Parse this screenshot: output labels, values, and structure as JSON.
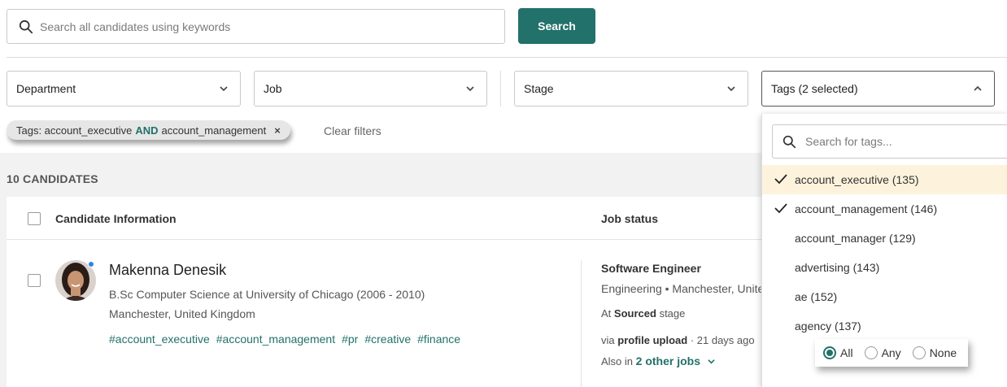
{
  "search": {
    "placeholder": "Search all candidates using keywords",
    "button_label": "Search"
  },
  "filters": {
    "department": "Department",
    "job": "Job",
    "stage": "Stage",
    "tags": "Tags (2 selected)"
  },
  "active_filter": {
    "prefix": "Tags: account_executive",
    "operator": "AND",
    "suffix": "account_management",
    "remove": "×"
  },
  "clear_filters_label": "Clear filters",
  "candidate_count": "10 CANDIDATES",
  "table_header": {
    "candidate_info": "Candidate Information",
    "job_status": "Job status"
  },
  "candidate": {
    "name": "Makenna Denesik",
    "education": "B.Sc Computer Science at University of Chicago (2006 - 2010)",
    "location": "Manchester, United Kingdom",
    "tags": [
      "#account_executive",
      "#account_management",
      "#pr",
      "#creative",
      "#finance"
    ],
    "job": {
      "title": "Software Engineer",
      "department_location": "Engineering • Manchester, United",
      "stage_prefix": "At",
      "stage": "Sourced",
      "stage_suffix": "stage",
      "via_prefix": "via",
      "via": "profile upload",
      "via_time": "· 21 days ago",
      "also_prefix": "Also in",
      "also_link": "2 other jobs"
    }
  },
  "tag_dropdown": {
    "search_placeholder": "Search for tags...",
    "options": [
      {
        "label": "account_executive (135)",
        "checked": true
      },
      {
        "label": "account_management (146)",
        "checked": true
      },
      {
        "label": "account_manager (129)",
        "checked": false
      },
      {
        "label": "advertising (143)",
        "checked": false
      },
      {
        "label": "ae (152)",
        "checked": false
      },
      {
        "label": "agency (137)",
        "checked": false
      }
    ],
    "match_mode": {
      "options": [
        "All",
        "Any",
        "None"
      ],
      "selected": "All"
    }
  },
  "colors": {
    "accent": "#22716a",
    "highlight": "#fdf3dc",
    "online_dot": "#2b83e6"
  }
}
